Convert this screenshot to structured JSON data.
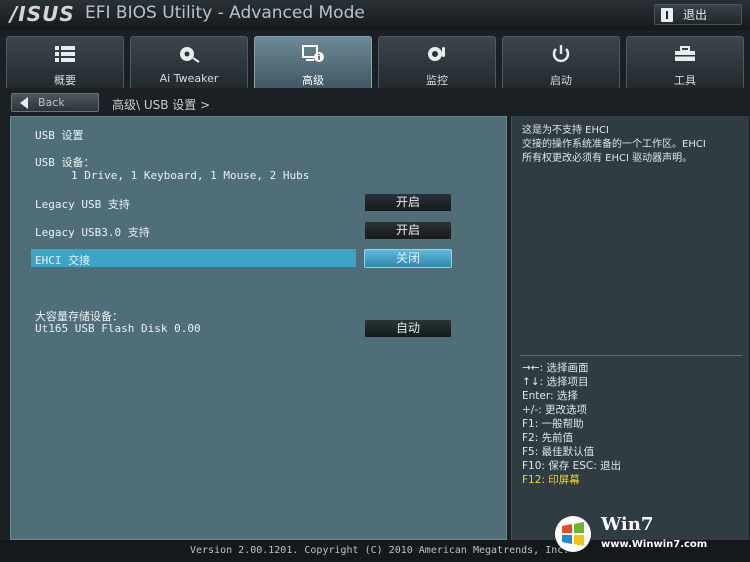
{
  "header": {
    "brand": "/ISUS",
    "title": "EFI BIOS Utility - Advanced Mode",
    "exit_label": "退出"
  },
  "tabs": [
    {
      "label": "概要",
      "icon": "list-icon"
    },
    {
      "label": "Ai Tweaker",
      "icon": "fan-icon"
    },
    {
      "label": "高级",
      "icon": "info-icon",
      "active": true
    },
    {
      "label": "监控",
      "icon": "thermometer-icon"
    },
    {
      "label": "启动",
      "icon": "power-icon"
    },
    {
      "label": "工具",
      "icon": "toolbox-icon"
    }
  ],
  "nav": {
    "back_label": "Back",
    "breadcrumb": "高级\\ USB 设置 >"
  },
  "main": {
    "section_title": "USB 设置",
    "devices_label": "USB 设备：",
    "devices_value": "1 Drive, 1 Keyboard, 1 Mouse, 2 Hubs",
    "settings": [
      {
        "label": "Legacy USB 支持",
        "value": "开启"
      },
      {
        "label": "Legacy USB3.0 支持",
        "value": "开启"
      },
      {
        "label": "EHCI 交接",
        "value": "关闭",
        "selected": true
      }
    ],
    "storage_label": "大容量存储设备：",
    "storage_device": {
      "label": "Ut165 USB Flash Disk 0.00",
      "value": "自动"
    }
  },
  "help": {
    "line1": "这是为不支持 EHCI",
    "line2": "交接的操作系统准备的一个工作区。EHCI",
    "line3": "所有权更改必须有 EHCI 驱动器声明。"
  },
  "keys": [
    "→←: 选择画面",
    "↑↓: 选择项目",
    "Enter: 选择",
    "+/-: 更改选项",
    "F1: 一般帮助",
    "F2: 先前值",
    "F5: 最佳默认值",
    "F10: 保存  ESC: 退出"
  ],
  "key_highlight": "F12: 印屏幕",
  "footer": {
    "version": "Version 2.00.1201. Copyright (C) 2010 American Megatrends, Inc."
  },
  "watermark": {
    "text1": "Win7",
    "text2": "www.Winwin7.com"
  },
  "colors": {
    "panel": "#4f6e78",
    "highlight": "#3aa5c6",
    "key_highlight": "#f2d32c"
  }
}
